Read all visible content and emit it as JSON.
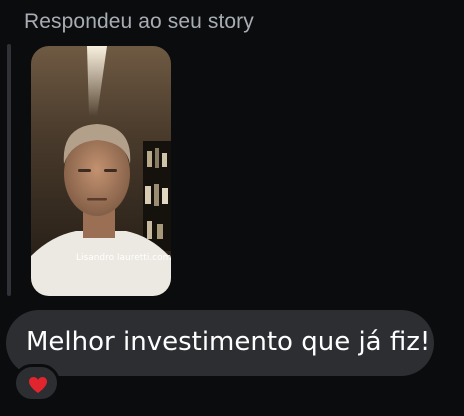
{
  "chat": {
    "reply_context": "Respondeu ao seu story",
    "story": {
      "watermark": "Lisandro lauretti.com.br"
    },
    "message": "Melhor investimento que já fiz!",
    "reaction": {
      "icon": "heart-icon",
      "color": "#e0252f"
    }
  }
}
